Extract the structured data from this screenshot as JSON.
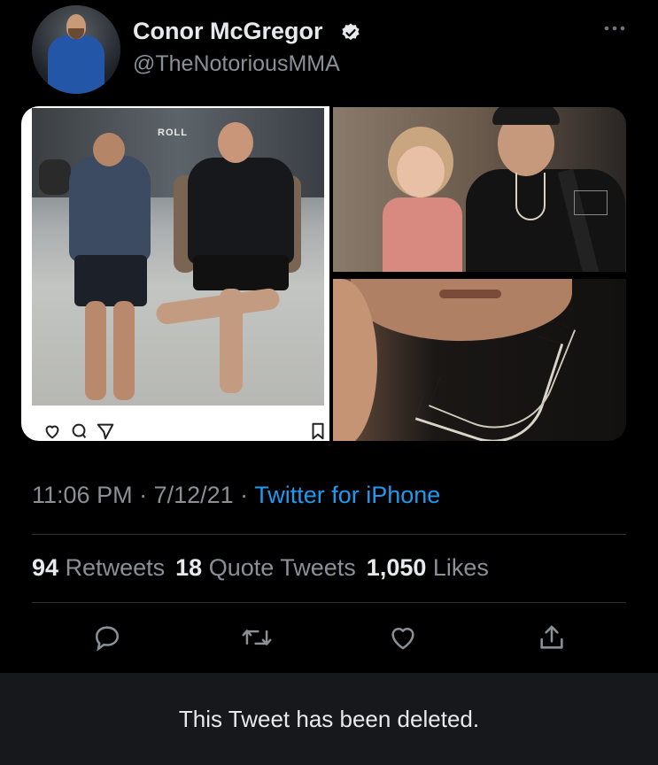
{
  "author": {
    "name": "Conor McGregor",
    "handle": "@TheNotoriousMMA",
    "verified": true,
    "avatar_icon": "profile-avatar"
  },
  "media": {
    "photo1_wall_text": "ROLL",
    "photo1_icons": [
      "heart-icon",
      "comment-icon",
      "share-icon",
      "bookmark-icon"
    ]
  },
  "tweet": {
    "time": "11:06 PM",
    "separator": " · ",
    "date": "7/12/21",
    "source": "Twitter for iPhone"
  },
  "stats": {
    "retweets_count": "94",
    "retweets_label": "Retweets",
    "quotes_count": "18",
    "quotes_label": "Quote Tweets",
    "likes_count": "1,050",
    "likes_label": "Likes"
  },
  "actions": [
    "reply-icon",
    "retweet-icon",
    "like-icon",
    "share-icon"
  ],
  "colors": {
    "background": "#000000",
    "link": "#1d9bf0",
    "muted": "#8b9096",
    "deleted_bar": "#16181c"
  },
  "banner": {
    "text": "This Tweet has been deleted."
  }
}
